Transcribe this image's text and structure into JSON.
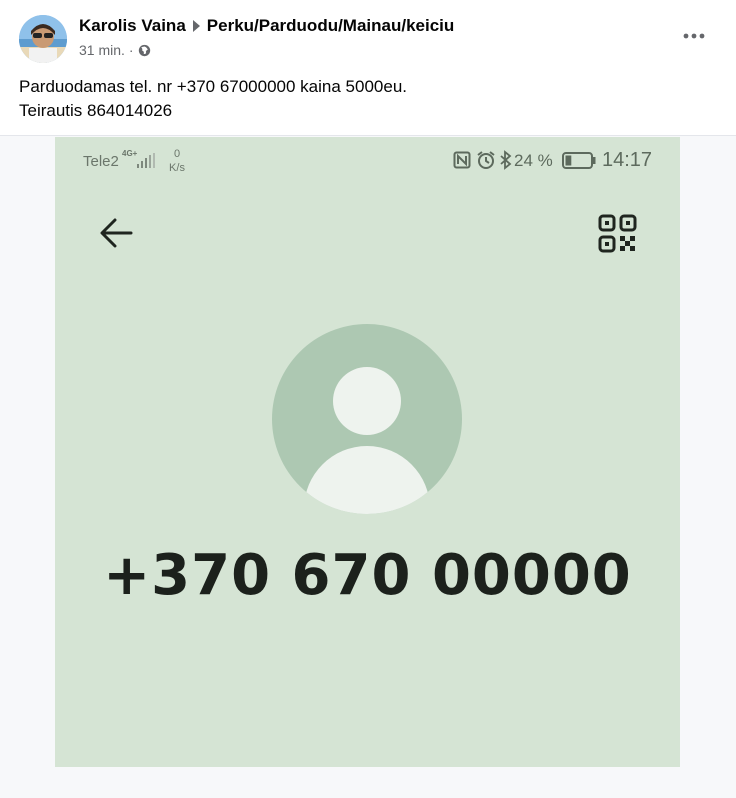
{
  "post": {
    "author": "Karolis Vaina",
    "group": "Perku/Parduodu/Mainau/keiciu",
    "time": "31 min.",
    "separator": "·",
    "privacy_icon": "globe-icon",
    "more_icon": "more-options-icon",
    "text_lines": [
      "Parduodamas tel. nr +370 67000000 kaina 5000eu.",
      "Teirautis 864014026"
    ]
  },
  "screenshot": {
    "background_color": "#d5e4d4",
    "status_bar": {
      "carrier": "Tele2",
      "network": "4G+",
      "speed_value": "0",
      "speed_unit": "K/s",
      "battery_percent": "24 %",
      "battery_level": 0.24,
      "time": "14:17",
      "icons": [
        "signal-icon",
        "nfc-icon",
        "alarm-icon",
        "bluetooth-icon",
        "battery-icon"
      ]
    },
    "toolbar": {
      "back_icon": "back-arrow-icon",
      "qr_icon": "qr-code-icon"
    },
    "contact": {
      "avatar_icon": "contact-avatar-icon",
      "phone_number": "+370 670 00000"
    }
  }
}
